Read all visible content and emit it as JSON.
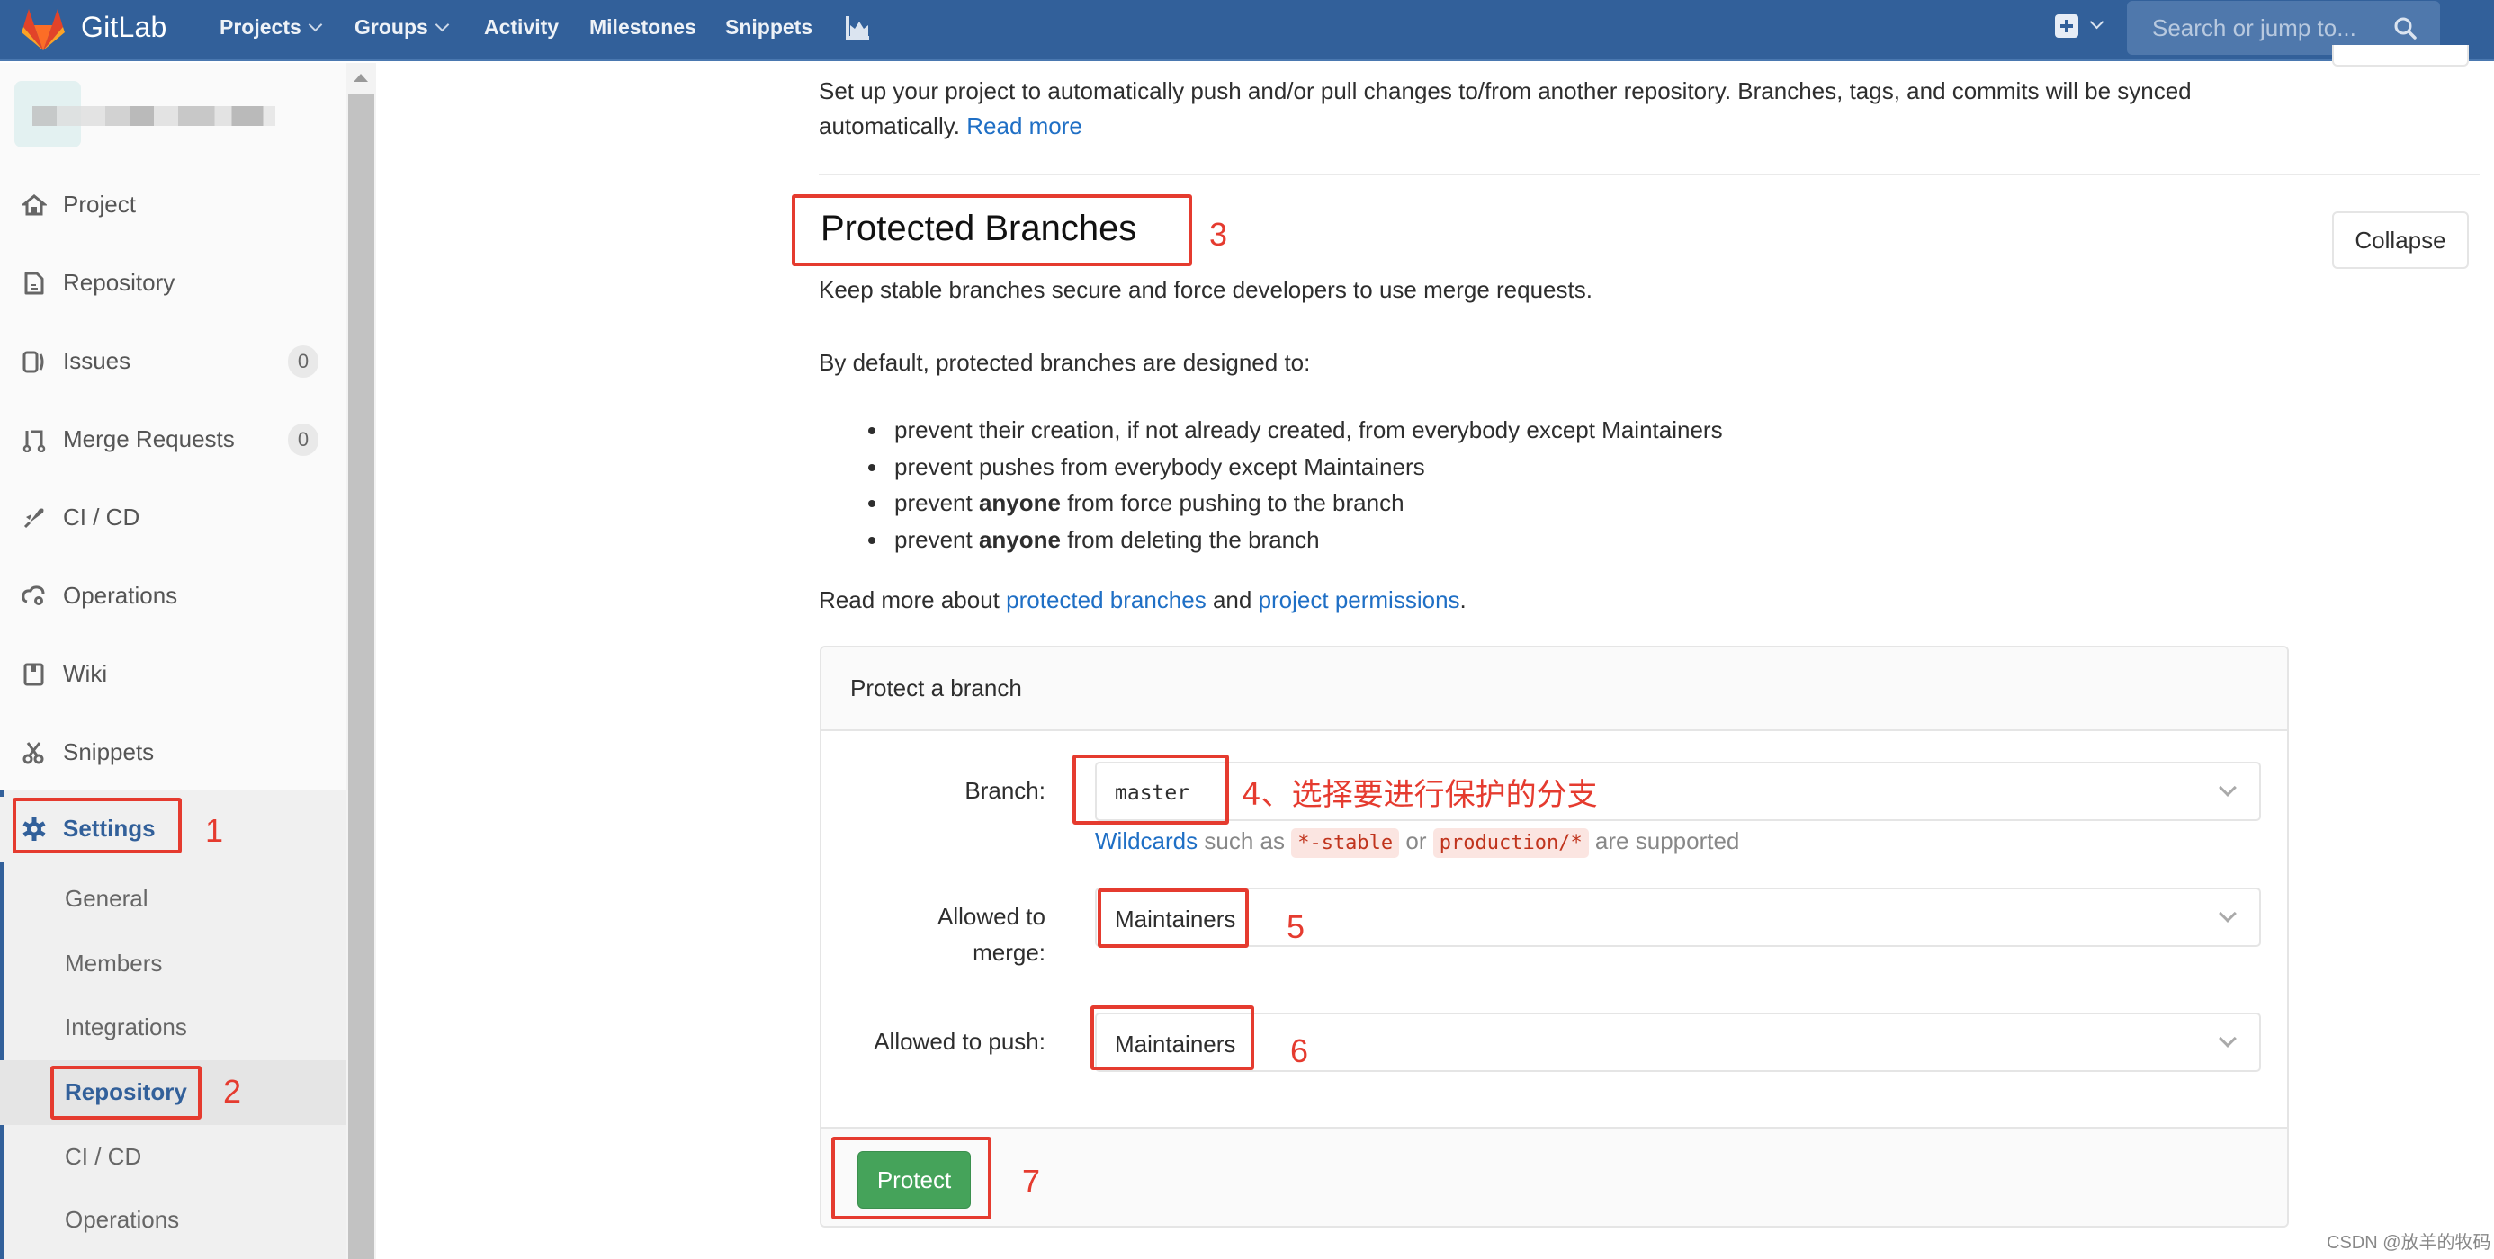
{
  "header": {
    "brand": "GitLab",
    "nav": [
      {
        "label": "Projects",
        "has_dropdown": true
      },
      {
        "label": "Groups",
        "has_dropdown": true
      },
      {
        "label": "Activity"
      },
      {
        "label": "Milestones"
      },
      {
        "label": "Snippets"
      }
    ],
    "chart_icon": "chart-icon",
    "new_icon": "plus-square-icon",
    "search_placeholder": "Search or jump to...",
    "search_icon": "search-icon",
    "colors": {
      "bar": "#32609a",
      "search_bg": "#4f78ac"
    }
  },
  "sidebar": {
    "project_name": "(blurred)",
    "items": [
      {
        "label": "Project",
        "icon": "home-icon"
      },
      {
        "label": "Repository",
        "icon": "document-icon"
      },
      {
        "label": "Issues",
        "icon": "issues-icon",
        "badge": "0"
      },
      {
        "label": "Merge Requests",
        "icon": "merge-request-icon",
        "badge": "0"
      },
      {
        "label": "CI / CD",
        "icon": "rocket-icon"
      },
      {
        "label": "Operations",
        "icon": "cloud-gear-icon"
      },
      {
        "label": "Wiki",
        "icon": "book-icon"
      },
      {
        "label": "Snippets",
        "icon": "scissors-icon"
      },
      {
        "label": "Settings",
        "icon": "gear-icon",
        "active": true
      }
    ],
    "settings_sub": [
      {
        "label": "General"
      },
      {
        "label": "Members"
      },
      {
        "label": "Integrations"
      },
      {
        "label": "Repository",
        "current": true
      },
      {
        "label": "CI / CD"
      },
      {
        "label": "Operations"
      }
    ]
  },
  "main": {
    "mirroring_text_1": "Set up your project to automatically push and/or pull changes to/from another repository. Branches, tags, and commits will be synced",
    "mirroring_text_2": "automatically.",
    "mirroring_read_more": "Read more",
    "section_title": "Protected Branches",
    "collapse_label": "Collapse",
    "intro": "Keep stable branches secure and force developers to use merge requests.",
    "default_text": "By default, protected branches are designed to:",
    "bullets": [
      {
        "pre": "prevent their creation, if not already created, from everybody except Maintainers",
        "bold": "",
        "post": ""
      },
      {
        "pre": "prevent pushes from everybody except Maintainers",
        "bold": "",
        "post": ""
      },
      {
        "pre": "prevent ",
        "bold": "anyone",
        "post": " from force pushing to the branch"
      },
      {
        "pre": "prevent ",
        "bold": "anyone",
        "post": " from deleting the branch"
      }
    ],
    "read_more_prefix": "Read more about ",
    "link_protected_branches": "protected branches",
    "read_more_and": " and ",
    "link_project_permissions": "project permissions",
    "read_more_suffix": ".",
    "panel": {
      "title": "Protect a branch",
      "branch_label": "Branch:",
      "branch_value": "master",
      "hint_link": "Wildcards",
      "hint_mid1": " such as ",
      "hint_code1": "*-stable",
      "hint_mid2": " or ",
      "hint_code2": "production/*",
      "hint_end": " are supported",
      "merge_label_1": "Allowed to",
      "merge_label_2": "merge:",
      "merge_value": "Maintainers",
      "push_label": "Allowed to push:",
      "push_value": "Maintainers",
      "protect_label": "Protect",
      "protect_color": "#45a35a"
    }
  },
  "annotations": {
    "color": "#e53b2f",
    "steps": [
      "1",
      "2",
      "3",
      "4、选择要进行保护的分支",
      "5",
      "6",
      "7"
    ]
  },
  "watermark": "CSDN @放羊的牧码"
}
